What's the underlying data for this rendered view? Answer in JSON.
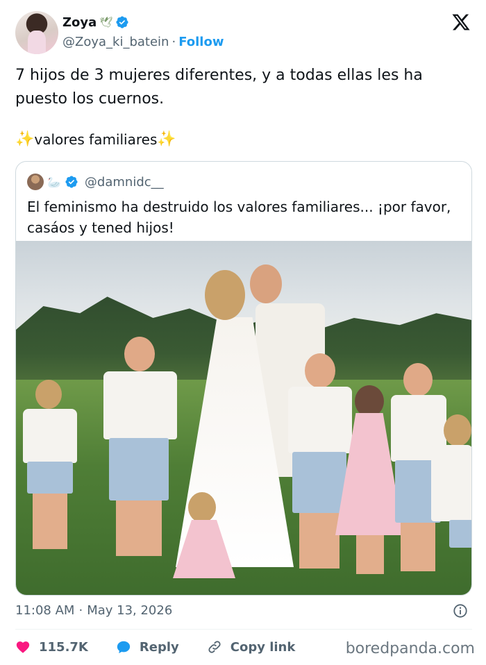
{
  "author": {
    "display_name": "Zoya",
    "name_emoji": "🕊",
    "handle": "@Zoya_ki_batein",
    "separator": "·",
    "follow_label": "Follow"
  },
  "icons": {
    "verified": "verified-badge-icon",
    "platform": "x-logo-icon",
    "like": "heart-icon",
    "reply": "speech-bubble-icon",
    "copy": "link-icon",
    "info": "info-icon"
  },
  "tweet": {
    "text": "7 hijos de 3 mujeres diferentes, y a todas ellas les ha puesto los cuernos.",
    "tag_text": "valores familiares",
    "sparkle": "✨"
  },
  "quote": {
    "handle": "@damnidc__",
    "emoji": "🦢",
    "text": "El feminismo ha destruido los valores familiares... ¡por favor, casáos y tened hijos!"
  },
  "meta": {
    "time": "11:08 AM",
    "separator": "·",
    "date": "May 13, 2026"
  },
  "actions": {
    "like_count": "115.7K",
    "reply_label": "Reply",
    "copy_label": "Copy link"
  },
  "watermark": "boredpanda.com",
  "colors": {
    "accent": "#1d9bf0",
    "like": "#f91880",
    "text": "#0f1419",
    "muted": "#536471"
  }
}
